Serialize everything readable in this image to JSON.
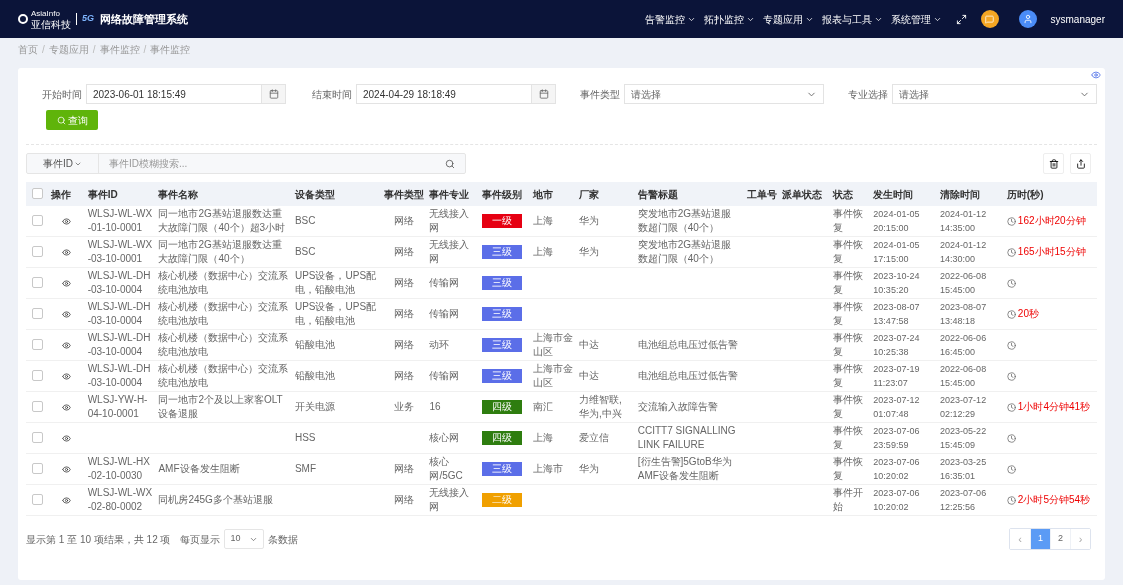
{
  "header": {
    "logo": {
      "brand": "AsiaInfo",
      "sub": "亚信科技",
      "badge": "5G"
    },
    "title": "网络故障管理系统",
    "menu": [
      "告警监控",
      "拓扑监控",
      "专题应用",
      "报表与工具",
      "系统管理"
    ],
    "user": "sysmanager"
  },
  "breadcrumb": {
    "items": [
      "首页",
      "专题应用",
      "事件监控",
      "事件监控"
    ],
    "separator": "/"
  },
  "filters": {
    "start": {
      "label": "开始时间",
      "value": "2023-06-01 18:15:49"
    },
    "end": {
      "label": "结束时间",
      "value": "2024-04-29 18:18:49"
    },
    "event_type": {
      "label": "事件类型",
      "placeholder": "请选择"
    },
    "specialty": {
      "label": "专业选择",
      "placeholder": "请选择"
    },
    "query": "查询"
  },
  "search": {
    "scope": "事件ID",
    "placeholder": "事件ID模糊搜索..."
  },
  "table": {
    "header_checked": false,
    "columns": [
      "操作",
      "事件ID",
      "事件名称",
      "设备类型",
      "事件类型",
      "事件专业",
      "事件级别",
      "地市",
      "厂家",
      "告警标题",
      "工单号",
      "派单状态",
      "状态",
      "发生时间",
      "清除时间",
      "历时(秒)"
    ],
    "rows": [
      {
        "checked": false,
        "id": "WLSJ-WL-WX-01-10-0001",
        "name": "同一地市2G基站退服数达重大故障门限（40个）超3小时",
        "device": "BSC",
        "type": "网络",
        "specialty": "无线接入网",
        "level": {
          "label": "一级",
          "color": "#e60012"
        },
        "city": "上海",
        "vendor": "华为",
        "alarm": "突发地市2G基站退服数超门限（40个）",
        "status": "事件恢复",
        "start": "2024-01-05 20:15:00",
        "clear": "2024-01-12 14:35:00",
        "duration": "162小时20分钟"
      },
      {
        "checked": false,
        "id": "WLSJ-WL-WX-03-10-0001",
        "name": "同一地市2G基站退服数达重大故障门限（40个）",
        "device": "BSC",
        "type": "网络",
        "specialty": "无线接入网",
        "level": {
          "label": "三级",
          "color": "#5b6ee8"
        },
        "city": "上海",
        "vendor": "华为",
        "alarm": "突发地市2G基站退服数超门限（40个）",
        "status": "事件恢复",
        "start": "2024-01-05 17:15:00",
        "clear": "2024-01-12 14:30:00",
        "duration": "165小时15分钟"
      },
      {
        "checked": false,
        "id": "WLSJ-WL-DH-03-10-0004",
        "name": "核心机楼（数据中心）交流系统电池放电",
        "device": "UPS设备，UPS配电，铅酸电池",
        "type": "网络",
        "specialty": "传输网",
        "level": {
          "label": "三级",
          "color": "#5b6ee8"
        },
        "status": "事件恢复",
        "start": "2023-10-24 10:35:20",
        "clear": "2022-06-08 15:45:00"
      },
      {
        "checked": false,
        "id": "WLSJ-WL-DH-03-10-0004",
        "name": "核心机楼（数据中心）交流系统电池放电",
        "device": "UPS设备，UPS配电，铅酸电池",
        "type": "网络",
        "specialty": "传输网",
        "level": {
          "label": "三级",
          "color": "#5b6ee8"
        },
        "status": "事件恢复",
        "start": "2023-08-07 13:47:58",
        "clear": "2023-08-07 13:48:18",
        "duration": "20秒"
      },
      {
        "checked": false,
        "id": "WLSJ-WL-DH-03-10-0004",
        "name": "核心机楼（数据中心）交流系统电池放电",
        "device": "铅酸电池",
        "type": "网络",
        "specialty": "动环",
        "level": {
          "label": "三级",
          "color": "#5b6ee8"
        },
        "city": "上海市金山区",
        "vendor": "中达",
        "alarm": "电池组总电压过低告警",
        "status": "事件恢复",
        "start": "2023-07-24 10:25:38",
        "clear": "2022-06-06 16:45:00"
      },
      {
        "checked": false,
        "id": "WLSJ-WL-DH-03-10-0004",
        "name": "核心机楼（数据中心）交流系统电池放电",
        "device": "铅酸电池",
        "type": "网络",
        "specialty": "传输网",
        "level": {
          "label": "三级",
          "color": "#5b6ee8"
        },
        "city": "上海市金山区",
        "vendor": "中达",
        "alarm": "电池组总电压过低告警",
        "status": "事件恢复",
        "start": "2023-07-19 11:23:07",
        "clear": "2022-06-08 15:45:00"
      },
      {
        "checked": false,
        "id": "WLSJ-YW-H-04-10-0001",
        "name": "同一地市2个及以上家客OLT设备退服",
        "device": "开关电源",
        "type": "业务",
        "specialty": "16",
        "level": {
          "label": "四级",
          "color": "#2e7d0f"
        },
        "city": "南汇",
        "vendor": "力维智联,华为,中兴",
        "alarm": "交流输入故障告警",
        "status": "事件恢复",
        "start": "2023-07-12 01:07:48",
        "clear": "2023-07-12 02:12:29",
        "duration": "1小时4分钟41秒"
      },
      {
        "checked": false,
        "device": "HSS",
        "specialty": "核心网",
        "level": {
          "label": "四级",
          "color": "#2e7d0f"
        },
        "city": "上海",
        "vendor": "爱立信",
        "alarm": "CCITT7 SIGNALLING LINK FAILURE",
        "status": "事件恢复",
        "start": "2023-07-06 23:59:59",
        "clear": "2023-05-22 15:45:09"
      },
      {
        "checked": false,
        "id": "WLSJ-WL-HX-02-10-0030",
        "name": "AMF设备发生阻断",
        "device": "SMF",
        "type": "网络",
        "specialty": "核心网/5GC",
        "level": {
          "label": "三级",
          "color": "#5b6ee8"
        },
        "city": "上海市",
        "vendor": "华为",
        "alarm": "[衍生告警]5GtoB华为AMF设备发生阻断",
        "status": "事件恢复",
        "start": "2023-07-06 10:20:02",
        "clear": "2023-03-25 16:35:01"
      },
      {
        "checked": false,
        "id": "WLSJ-WL-WX-02-80-0002",
        "name": "同机房245G多个基站退服",
        "type": "网络",
        "specialty": "无线接入网",
        "level": {
          "label": "二级",
          "color": "#f0a000"
        },
        "status": "事件开始",
        "start": "2023-07-06 10:20:02",
        "clear": "2023-07-06 12:25:56",
        "duration": "2小时5分钟54秒"
      }
    ]
  },
  "footer": {
    "summary": "显示第 1 至 10 项结果，共 12 项",
    "per_page_label": "每页显示",
    "per_page": "10",
    "per_page_suffix": "条数据",
    "pages": [
      {
        "kind": "prev",
        "label": "‹",
        "selected": false
      },
      {
        "kind": "page",
        "label": "1",
        "selected": true
      },
      {
        "kind": "page",
        "label": "2",
        "selected": false
      },
      {
        "kind": "next",
        "label": "›",
        "selected": false
      }
    ]
  }
}
